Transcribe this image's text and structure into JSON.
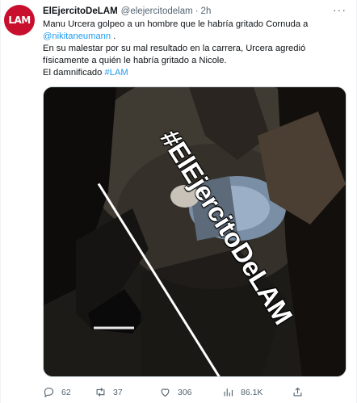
{
  "tweet": {
    "avatar_text": "LAM",
    "display_name": "ElEjercitoDeLAM",
    "handle": "@elejercitodelam",
    "dot": "·",
    "time": "2h",
    "more": "···",
    "text": {
      "line1": "Manu Urcera golpeo a un hombre que le habría gritado Cornuda a",
      "mention": "@nikitaneumann",
      "mention_suffix": " .",
      "line3": "En su malestar por su mal resultado en la carrera, Urcera agredió",
      "line4": "físicamente a quién le habría gritado a Nicole.",
      "line5_prefix": "El damnificado ",
      "hashtag": "#LAM"
    },
    "media": {
      "watermark": "#ElEjercitoDeLAM"
    },
    "actions": {
      "replies": "62",
      "retweets": "37",
      "likes": "306",
      "views": "86.1K"
    }
  },
  "colors": {
    "link": "#1d9bf0",
    "muted": "#536471",
    "avatar_bg": "#c8102e"
  }
}
